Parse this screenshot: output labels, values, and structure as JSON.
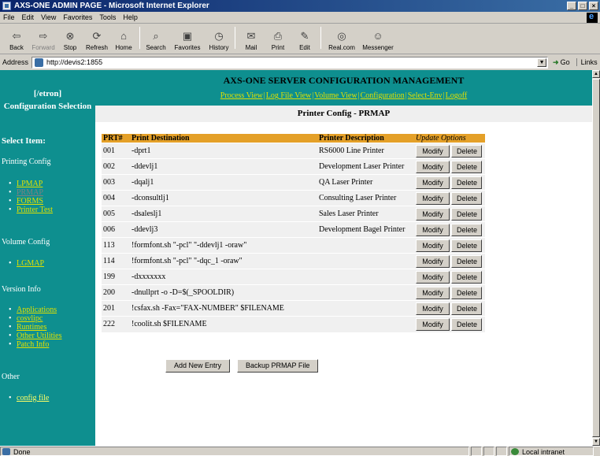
{
  "window": {
    "title": "AXS-ONE ADMIN PAGE - Microsoft Internet Explorer"
  },
  "menu": [
    "File",
    "Edit",
    "View",
    "Favorites",
    "Tools",
    "Help"
  ],
  "toolbar": {
    "back": "Back",
    "forward": "Forward",
    "stop": "Stop",
    "refresh": "Refresh",
    "home": "Home",
    "search": "Search",
    "favorites": "Favorites",
    "history": "History",
    "mail": "Mail",
    "print": "Print",
    "edit": "Edit",
    "realcom": "Real.com",
    "messenger": "Messenger"
  },
  "address": {
    "label": "Address",
    "url": "http://devis2:1855",
    "go": "Go",
    "links": "Links"
  },
  "sidebar": {
    "heading_user": "[/etron]",
    "heading_title": "Configuration Selection",
    "select_item": "Select Item:",
    "sections": {
      "printing": {
        "label": "Printing Config",
        "items": [
          "LPMAP",
          "PRMAP",
          "FORMS",
          "Printer Test"
        ]
      },
      "volume": {
        "label": "Volume Config",
        "items": [
          "LGMAP"
        ]
      },
      "version": {
        "label": "Version Info",
        "items": [
          "Applications",
          "cosvlipc",
          "Runtimes",
          "Other Utilities",
          "Patch Info"
        ]
      },
      "other": {
        "label": "Other",
        "items": [
          "config file"
        ]
      }
    }
  },
  "header": {
    "title": "AXS-ONE SERVER CONFIGURATION MANAGEMENT",
    "nav": [
      "Process View",
      "Log File View",
      "Volume View",
      "Configuration",
      "Select-Env",
      "Logoff"
    ]
  },
  "panel": {
    "title": "Printer Config - PRMAP"
  },
  "table": {
    "columns": {
      "prt": "PRT#",
      "dest": "Print Destination",
      "desc": "Printer Description",
      "update": "Update Options"
    },
    "modify_label": "Modify",
    "delete_label": "Delete",
    "rows": [
      {
        "prt": "001",
        "dest": "-dprt1",
        "desc": "RS6000 Line Printer"
      },
      {
        "prt": "002",
        "dest": "-ddevlj1",
        "desc": "Development Laser Printer"
      },
      {
        "prt": "003",
        "dest": "-dqalj1",
        "desc": "QA Laser Printer"
      },
      {
        "prt": "004",
        "dest": "-dconsultlj1",
        "desc": "Consulting Laser Printer"
      },
      {
        "prt": "005",
        "dest": "-dsaleslj1",
        "desc": "Sales Laser Printer"
      },
      {
        "prt": "006",
        "dest": "-ddevlj3",
        "desc": "Development Bagel Printer"
      },
      {
        "prt": "113",
        "dest": "!formfont.sh \"-pcl\" \"-ddevlj1 -oraw\"",
        "desc": ""
      },
      {
        "prt": "114",
        "dest": "!formfont.sh \"-pcl\" \"-dqc_1 -oraw\"",
        "desc": ""
      },
      {
        "prt": "199",
        "dest": "-dxxxxxxx",
        "desc": ""
      },
      {
        "prt": "200",
        "dest": "-dnullprt -o -D=$(_SPOOLDIR)",
        "desc": ""
      },
      {
        "prt": "201",
        "dest": "!csfax.sh -Fax=\"FAX-NUMBER\" $FILENAME",
        "desc": ""
      },
      {
        "prt": "222",
        "dest": "!coolit.sh $FILENAME",
        "desc": ""
      }
    ]
  },
  "actions": {
    "add": "Add New Entry",
    "backup": "Backup PRMAP File"
  },
  "status": {
    "text": "Done",
    "zone": "Local intranet"
  },
  "colors": {
    "sidebar_bg": "#0e8f8f",
    "header_row": "#e4a028",
    "link": "#e0e000"
  }
}
